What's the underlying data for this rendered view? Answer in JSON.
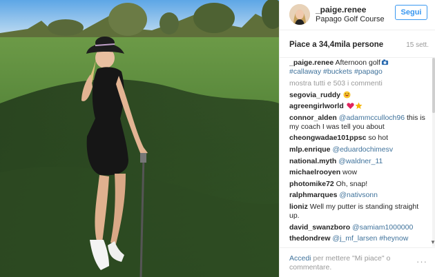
{
  "post": {
    "owner": "_paige.renee",
    "location": "Papago Golf Course",
    "follow_label": "Segui",
    "likes": "Piace a 34,4mila persone",
    "time": "15 sett.",
    "caption_user": "_paige.renee",
    "caption_text": "Afternoon golf",
    "caption_tags": "#callaway #buckets #papago",
    "more_comments": "mostra tutti e 503 i commenti"
  },
  "comments": [
    {
      "user": "segovia_ruddy",
      "mention": "",
      "text": ""
    },
    {
      "user": "agreengirlworld",
      "mention": "",
      "text": ""
    },
    {
      "user": "connor_alden",
      "mention": "@adammcculloch96",
      "text": " this is my coach I was tell you about"
    },
    {
      "user": "cheongwadae101ppsc",
      "mention": "",
      "text": " so hot"
    },
    {
      "user": "mlp.enrique",
      "mention": "@eduardochimesv",
      "text": ""
    },
    {
      "user": "national.myth",
      "mention": "@waldner_11",
      "text": ""
    },
    {
      "user": "michaelrooyen",
      "mention": "",
      "text": " wow"
    },
    {
      "user": "photomike72",
      "mention": "",
      "text": " Oh, snap!"
    },
    {
      "user": "ralphmarques",
      "mention": "@nativsonn",
      "text": ""
    },
    {
      "user": "lioniz",
      "mention": "",
      "text": " Well my putter is standing straight up."
    },
    {
      "user": "david_swanzboro",
      "mention": "@samiam1000000",
      "text": ""
    },
    {
      "user": "thedondrew",
      "mention": "@j_mf_larsen #heynow",
      "text": ""
    }
  ],
  "footer": {
    "login_link": "Accedi",
    "login_text": " per mettere \"Mi piace\" o commentare.",
    "options": "···"
  },
  "icons": {
    "avatar": "profile-photo",
    "emoji_1": "grinning-face-emoji",
    "emoji_2": "heart-emoji",
    "emoji_3": "star-emoji",
    "emoji_4": "camera-emoji"
  },
  "colors": {
    "link": "#3f729b",
    "follow": "#3897f0",
    "muted": "#999999"
  }
}
